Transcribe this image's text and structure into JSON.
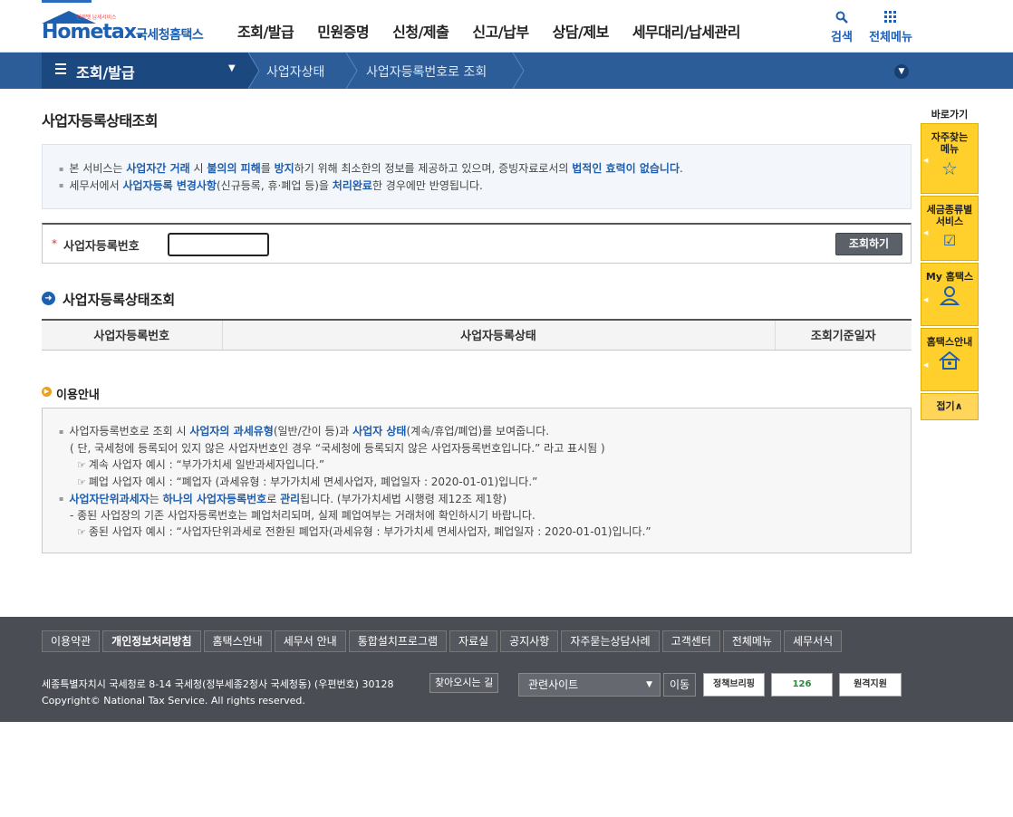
{
  "header": {
    "logo_sub": "언제쨋 납세서비스",
    "logo_main": "Hometax.",
    "logo_kr": "국세청홈택스",
    "gnb": [
      "조회/발급",
      "민원증명",
      "신청/제출",
      "신고/납부",
      "상담/제보",
      "세무대리/납세관리"
    ],
    "search_label": "검색",
    "allmenu_label": "전체메뉴",
    "search_icon": "search-icon",
    "allmenu_icon": "grid-icon"
  },
  "subnav": {
    "title": "조회/발급",
    "crumbs": [
      "사업자상태",
      "사업자등록번호로 조회"
    ]
  },
  "main": {
    "page_title": "사업자등록상태조회",
    "notice": {
      "line1": {
        "a": "본 서비스는 ",
        "b": "사업자간 거래",
        "c": " 시 ",
        "d": "불의의 피해",
        "e": "를 ",
        "f": "방지",
        "g": "하기 위해 최소한의 정보를 제공하고 있으며, 증빙자료로서의 ",
        "h": "법적인 효력이 없습니다",
        "i": "."
      },
      "line2": {
        "a": "세무서에서 ",
        "b": "사업자등록 변경사항",
        "c": "(신규등록, 휴·폐업 등)을 ",
        "d": "처리완료",
        "e": "한 경우에만 반영됩니다."
      }
    },
    "search": {
      "required_mark": "*",
      "label": "사업자등록번호",
      "input_value": "",
      "button": "조회하기"
    },
    "section_title": "사업자등록상태조회",
    "table_headers": [
      "사업자등록번호",
      "사업자등록상태",
      "조회기준일자"
    ],
    "guide_title": "이용안내",
    "guide": {
      "l1": {
        "a": "사업자등록번호로 조회 시 ",
        "b": "사업자의 과세유형",
        "c": "(일반/간이 등)과 ",
        "d": "사업자 상태",
        "e": "(계속/휴업/폐업)를 보여줍니다."
      },
      "l2": "( 단, 국세청에 등록되어 있지 않은 사업자번호인 경우 “국세청에 등록되지 않은 사업자등록번호입니다.” 라고 표시됨 )",
      "l3": "계속 사업자 예시 : “부가가치세 일반과세자입니다.”",
      "l4": "폐업 사업자 예시 : “폐업자 (과세유형 : 부가가치세 면세사업자, 폐업일자 : 2020-01-01)입니다.”",
      "l5": {
        "a": "사업자단위과세자",
        "b": "는 ",
        "c": "하나의 사업자등록번호",
        "d": "로 ",
        "e": "관리",
        "f": "됩니다. (부가가치세법 시행령 제12조 제1항)"
      },
      "l6": "- 종된 사업장의 기존 사업자등록번호는 폐업처리되며, 실제 폐업여부는 거래처에 확인하시기 바랍니다.",
      "l7": "종된 사업자 예시 : “사업자단위과세로 전환된 폐업자(과세유형 : 부가가치세 면세사업자, 폐업일자 : 2020-01-01)입니다.”"
    }
  },
  "quick": {
    "title": "바로가기",
    "items": [
      {
        "label": "자주찾는\n메뉴",
        "icon": "star-icon"
      },
      {
        "label": "세금종류별\n서비스",
        "icon": "checkbox-icon"
      },
      {
        "label": "My 홈택스",
        "icon": "user-icon"
      },
      {
        "label": "홈택스안내",
        "icon": "house-icon"
      }
    ],
    "fold": "접기∧"
  },
  "footer": {
    "links": [
      "이용약관",
      "개인정보처리방침",
      "홈택스안내",
      "세무서 안내",
      "통합설치프로그램",
      "자료실",
      "공지사항",
      "자주묻는상담사례",
      "고객센터",
      "전체메뉴",
      "세무서식"
    ],
    "address": "세종특별자치시 국세청로 8-14 국세청(정부세종2청사 국세청동) (우편번호) 30128",
    "map_btn": "찾아오시는 길",
    "copyright": "Copyright© National Tax Service. All rights reserved.",
    "related_select": "관련사이트",
    "go_btn": "이동",
    "banners": [
      "정책브리핑",
      "126",
      "원격지원"
    ]
  },
  "colors": {
    "brand": "#1d5fb0",
    "subnav": "#2c5d99",
    "subnav_dark": "#1c4880",
    "quick_yellow": "#ffd02b",
    "footer": "#4b4d54"
  }
}
